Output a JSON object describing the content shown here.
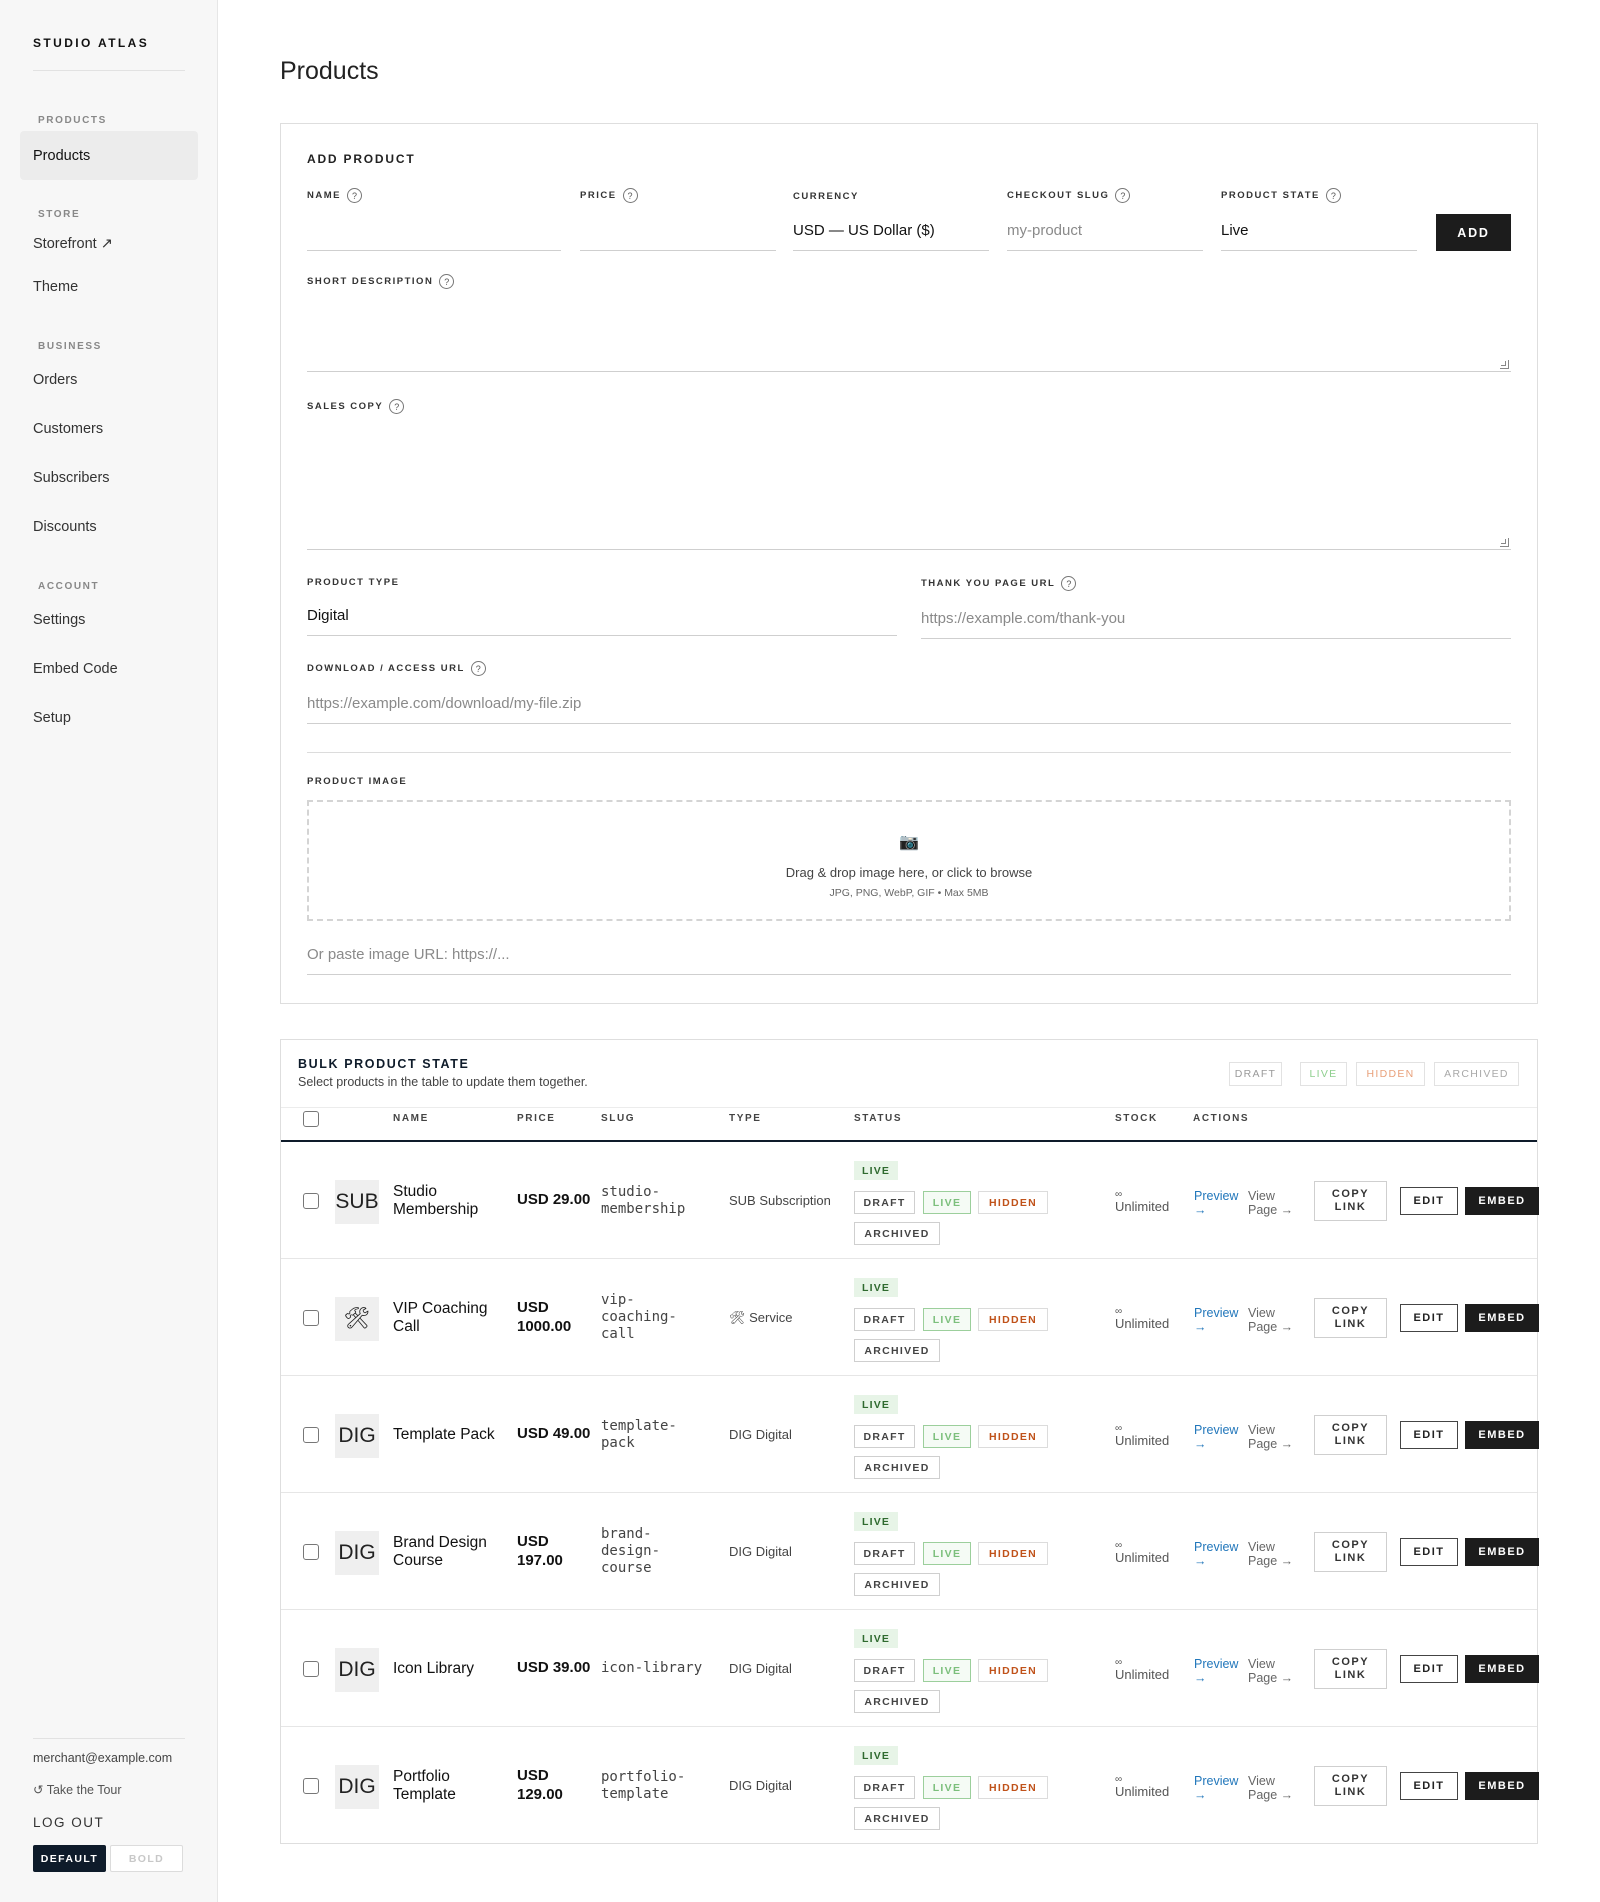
{
  "sidebar": {
    "brand": "STUDIO ATLAS",
    "sections": [
      {
        "title": "PRODUCTS",
        "items": [
          "Products"
        ]
      },
      {
        "title": "STORE",
        "items": [
          "Storefront ↗",
          "Theme"
        ]
      },
      {
        "title": "BUSINESS",
        "items": [
          "Orders",
          "Customers",
          "Subscribers",
          "Discounts"
        ]
      },
      {
        "title": "ACCOUNT",
        "items": [
          "Settings",
          "Embed Code",
          "Setup"
        ]
      }
    ],
    "active_item": "Products",
    "email": "merchant@example.com",
    "tour": "↺ Take the Tour",
    "logout": "LOG OUT",
    "theme_default": "DEFAULT",
    "theme_bold": "BOLD"
  },
  "page": {
    "title": "Products"
  },
  "form": {
    "title": "ADD PRODUCT",
    "name_label": "NAME",
    "name_value": "",
    "price_label": "PRICE",
    "price_value": "",
    "currency_label": "CURRENCY",
    "currency_value": "USD — US Dollar ($)",
    "slug_label": "CHECKOUT SLUG",
    "slug_placeholder": "my-product",
    "state_label": "PRODUCT STATE",
    "state_value": "Live",
    "add_button": "ADD",
    "short_desc_label": "SHORT DESCRIPTION",
    "sales_copy_label": "SALES COPY",
    "type_label": "PRODUCT TYPE",
    "type_value": "Digital",
    "thanks_label": "THANK YOU PAGE URL",
    "thanks_placeholder": "https://example.com/thank-you",
    "download_label": "DOWNLOAD / ACCESS URL",
    "download_placeholder": "https://example.com/download/my-file.zip",
    "image_label": "PRODUCT IMAGE",
    "dropzone_icon": "📷",
    "dropzone_text": "Drag & drop image here, or click to browse",
    "dropzone_sub": "JPG, PNG, WebP, GIF • Max 5MB",
    "image_url_placeholder": "Or paste image URL: https://..."
  },
  "bulk": {
    "title": "BULK PRODUCT STATE",
    "subtitle": "Select products in the table to update them together.",
    "buttons": {
      "draft": "DRAFT",
      "live": "LIVE",
      "hidden": "HIDDEN",
      "archived": "ARCHIVED"
    }
  },
  "table": {
    "headers": {
      "name": "NAME",
      "price": "PRICE",
      "slug": "SLUG",
      "type": "TYPE",
      "status": "STATUS",
      "stock": "STOCK",
      "actions": "ACTIONS"
    },
    "rows": [
      {
        "thumb": "SUB",
        "name": "Studio Membership",
        "price": "USD 29.00",
        "slug": "studio-\nmembership",
        "type": "SUB Subscription",
        "stock_icon": "∞",
        "stock": "Unlimited"
      },
      {
        "thumb": "🛠",
        "name": "VIP Coaching Call",
        "price": "USD 1000.00",
        "slug": "vip-\ncoaching-\ncall",
        "type": "🛠 Service",
        "stock_icon": "∞",
        "stock": "Unlimited"
      },
      {
        "thumb": "DIG",
        "name": "Template Pack",
        "price": "USD 49.00",
        "slug": "template-\npack",
        "type": "DIG Digital",
        "stock_icon": "∞",
        "stock": "Unlimited"
      },
      {
        "thumb": "DIG",
        "name": "Brand Design Course",
        "price": "USD 197.00",
        "slug": "brand-\ndesign-\ncourse",
        "type": "DIG Digital",
        "stock_icon": "∞",
        "stock": "Unlimited"
      },
      {
        "thumb": "DIG",
        "name": "Icon Library",
        "price": "USD 39.00",
        "slug": "icon-library",
        "type": "DIG Digital",
        "stock_icon": "∞",
        "stock": "Unlimited"
      },
      {
        "thumb": "DIG",
        "name": "Portfolio Template",
        "price": "USD 129.00",
        "slug": "portfolio-\ntemplate",
        "type": "DIG Digital",
        "stock_icon": "∞",
        "stock": "Unlimited"
      }
    ],
    "status_labels": {
      "current": "LIVE",
      "draft": "DRAFT",
      "live": "LIVE",
      "hidden": "HIDDEN",
      "archived": "ARCHIVED"
    },
    "action_labels": {
      "preview": "Preview →",
      "view": "View Page →",
      "copy": "COPY LINK",
      "edit": "EDIT",
      "embed": "EMBED"
    }
  },
  "colors": {
    "accent": "#0e1b2a",
    "live_green": "#2f6a2f",
    "hidden_orange": "#c0521a",
    "link_blue": "#2277bb"
  }
}
